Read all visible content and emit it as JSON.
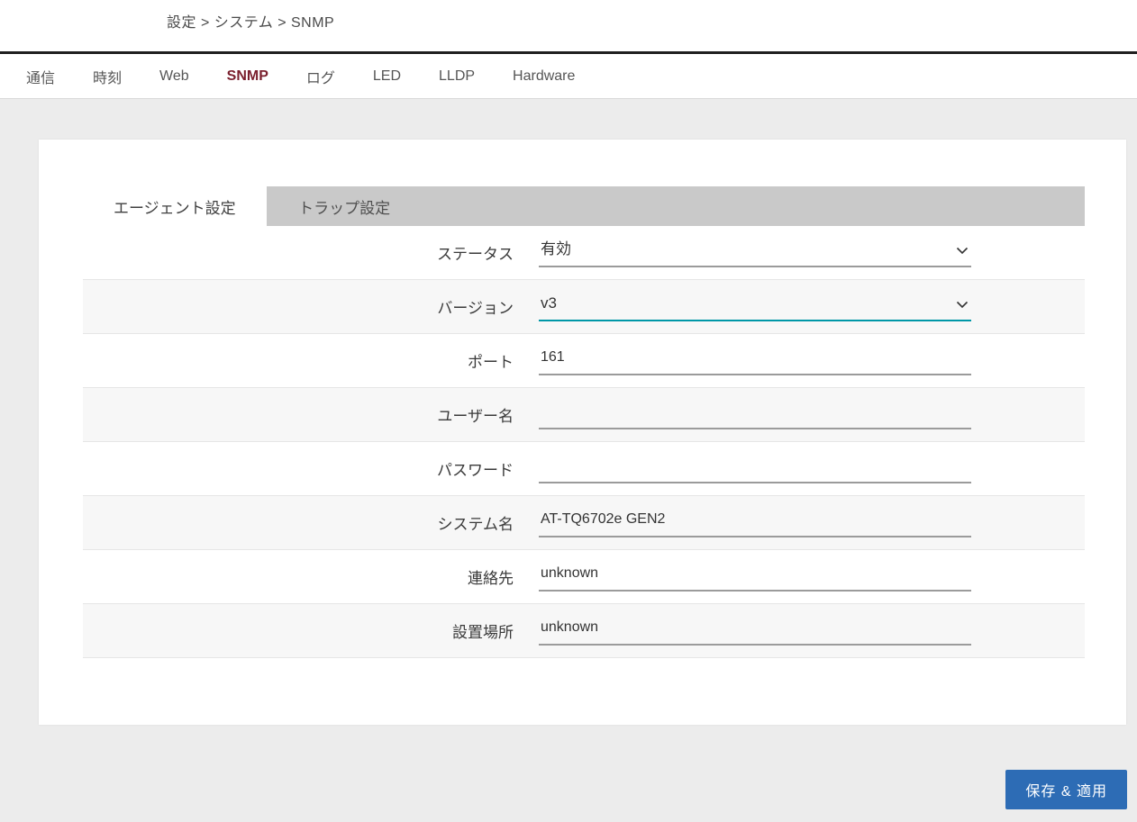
{
  "breadcrumb": "設定 > システム > SNMP",
  "tabs": [
    {
      "label": "通信"
    },
    {
      "label": "時刻"
    },
    {
      "label": "Web"
    },
    {
      "label": "SNMP"
    },
    {
      "label": "ログ"
    },
    {
      "label": "LED"
    },
    {
      "label": "LLDP"
    },
    {
      "label": "Hardware"
    }
  ],
  "subtabs": [
    {
      "label": "エージェント設定"
    },
    {
      "label": "トラップ設定"
    }
  ],
  "form": {
    "rows": [
      {
        "label": "ステータス",
        "value": "有効",
        "type": "select"
      },
      {
        "label": "バージョン",
        "value": "v3",
        "type": "select"
      },
      {
        "label": "ポート",
        "value": "161",
        "type": "text"
      },
      {
        "label": "ユーザー名",
        "value": "",
        "type": "text"
      },
      {
        "label": "パスワード",
        "value": "",
        "type": "text"
      },
      {
        "label": "システム名",
        "value": "AT-TQ6702e GEN2",
        "type": "text"
      },
      {
        "label": "連絡先",
        "value": "unknown",
        "type": "text"
      },
      {
        "label": "設置場所",
        "value": "unknown",
        "type": "text"
      }
    ]
  },
  "actions": {
    "save_label": "保存 & 適用"
  },
  "colors": {
    "active_tab": "#7a1f2d",
    "accent_underline": "#0097a7",
    "save_button": "#2d6cb5"
  }
}
